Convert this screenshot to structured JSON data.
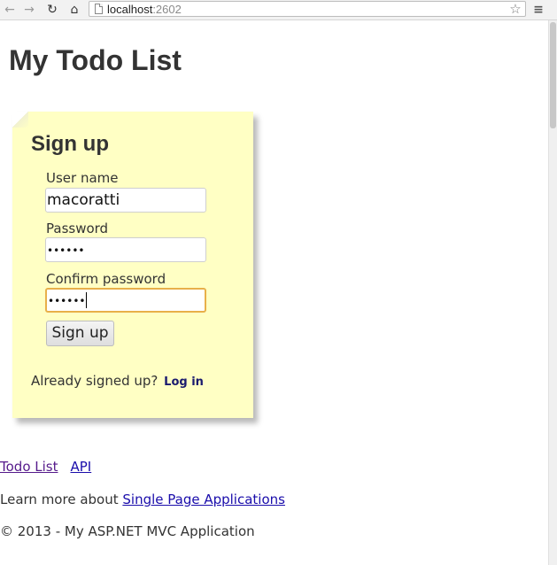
{
  "browser": {
    "url_host": "localhost",
    "url_port": ":2602",
    "icons": {
      "back": "back-arrow-icon",
      "forward": "forward-arrow-icon",
      "reload": "reload-icon",
      "home": "home-icon",
      "bookmark": "star-icon",
      "menu": "menu-icon"
    }
  },
  "page": {
    "title": "My Todo List"
  },
  "signup": {
    "heading": "Sign up",
    "username_label": "User name",
    "username_value": "macoratti",
    "password_label": "Password",
    "password_value": "••••••",
    "confirm_label": "Confirm password",
    "confirm_value": "••••••",
    "submit_label": "Sign up",
    "already_text": "Already signed up?",
    "login_link": "Log in"
  },
  "footer_nav": {
    "todo_link": "Todo List",
    "api_link": "API",
    "learn_prefix": "Learn more about",
    "spa_link": "Single Page Applications",
    "copyright": "© 2013 - My ASP.NET MVC Application"
  },
  "colors": {
    "note_background": "#ffffc4",
    "focus_border": "#e8b04a",
    "link": "#1a0dab",
    "visited_link": "#551a8b"
  }
}
